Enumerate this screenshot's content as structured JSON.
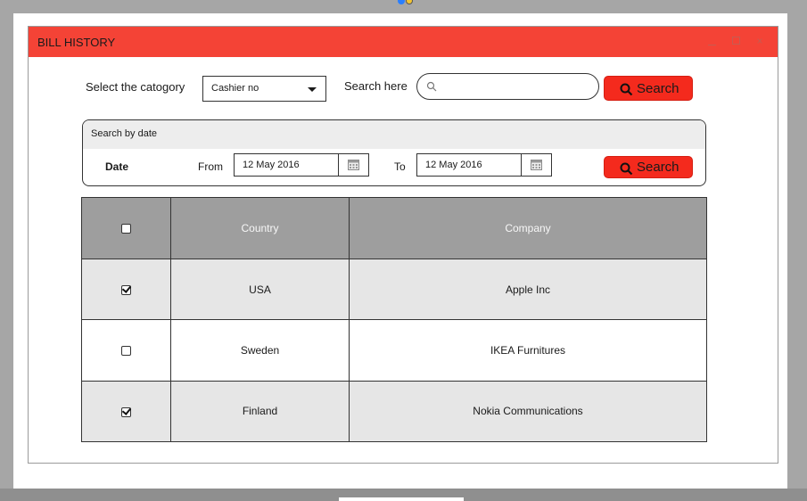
{
  "window": {
    "title": "BILL HISTORY",
    "close_glyph": "×"
  },
  "filter": {
    "category_label": "Select the catogory",
    "category_value": "Cashier no",
    "search_label": "Search here",
    "search_value": "",
    "search_button_label": "Search"
  },
  "date_panel": {
    "header": "Search by date",
    "date_label": "Date",
    "from_label": "From",
    "from_value": "12 May 2016",
    "to_label": "To",
    "to_value": "12 May 2016",
    "search_button_label": "Search"
  },
  "table": {
    "columns": [
      "Country",
      "Company"
    ],
    "rows": [
      {
        "checked": true,
        "country": "USA",
        "company": "Apple Inc"
      },
      {
        "checked": false,
        "country": "Sweden",
        "company": "IKEA Furnitures"
      },
      {
        "checked": true,
        "country": "Finland",
        "company": "Nokia Communications"
      }
    ]
  },
  "colors": {
    "accent": "#f44336",
    "button": "#f42a1d",
    "header_bg": "#9e9e9e",
    "row_shade": "#e6e6e6"
  },
  "icons": [
    "search-icon",
    "calendar-icon",
    "chevron-down-icon",
    "close-icon",
    "minimize-icon",
    "maximize-icon",
    "checkbox-icon"
  ]
}
